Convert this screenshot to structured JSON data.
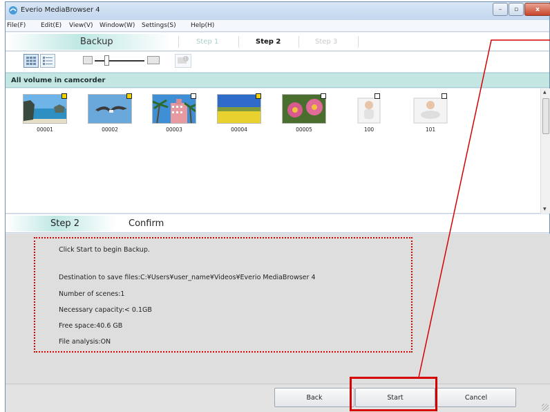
{
  "window": {
    "title": "Everio MediaBrowser 4",
    "controls": {
      "minimize": "–",
      "maximize": "▫",
      "close": "x"
    }
  },
  "menu": {
    "items": [
      "File(F)",
      "Edit(E)",
      "View(V)",
      "Window(W)",
      "Settings(S)",
      "Help(H)"
    ]
  },
  "steps": {
    "mode": "Backup",
    "items": [
      {
        "label": "Step 1",
        "state": "inactive"
      },
      {
        "label": "Step 2",
        "state": "active"
      },
      {
        "label": "Step 3",
        "state": "disabled"
      }
    ]
  },
  "toolbar": {
    "view_thumbnail": "thumbnail-view-icon",
    "view_details": "list-view-icon",
    "zoom_out": "zoom-out-icon",
    "zoom_in": "zoom-in-icon",
    "info": "info-icon",
    "zoom_level": 0.2
  },
  "volume": {
    "title": "All volume in camcorder",
    "thumbnails": [
      {
        "name": "00001",
        "selected": true,
        "scene": "beach"
      },
      {
        "name": "00002",
        "selected": true,
        "scene": "seagull"
      },
      {
        "name": "00003",
        "selected": false,
        "scene": "palm-hotel"
      },
      {
        "name": "00004",
        "selected": true,
        "scene": "field"
      },
      {
        "name": "00005",
        "selected": false,
        "scene": "flowers"
      },
      {
        "name": "100",
        "selected": false,
        "scene": "baby-sitting"
      },
      {
        "name": "101",
        "selected": false,
        "scene": "baby-crawling"
      }
    ]
  },
  "confirm": {
    "step": "Step 2",
    "title": "Confirm",
    "lines": [
      "Click Start to begin Backup.",
      "Destination to save files:C:¥Users¥user_name¥Videos¥Everio MediaBrowser 4",
      "Number of scenes:1",
      "Necessary capacity:< 0.1GB",
      "Free space:40.6 GB",
      "File analysis:ON"
    ]
  },
  "buttons": {
    "back": "Back",
    "start": "Start",
    "cancel": "Cancel"
  },
  "colors": {
    "accent_teal": "#c3e6e3",
    "annotation_red": "#d60000",
    "selected_badge": "#f2d200"
  }
}
